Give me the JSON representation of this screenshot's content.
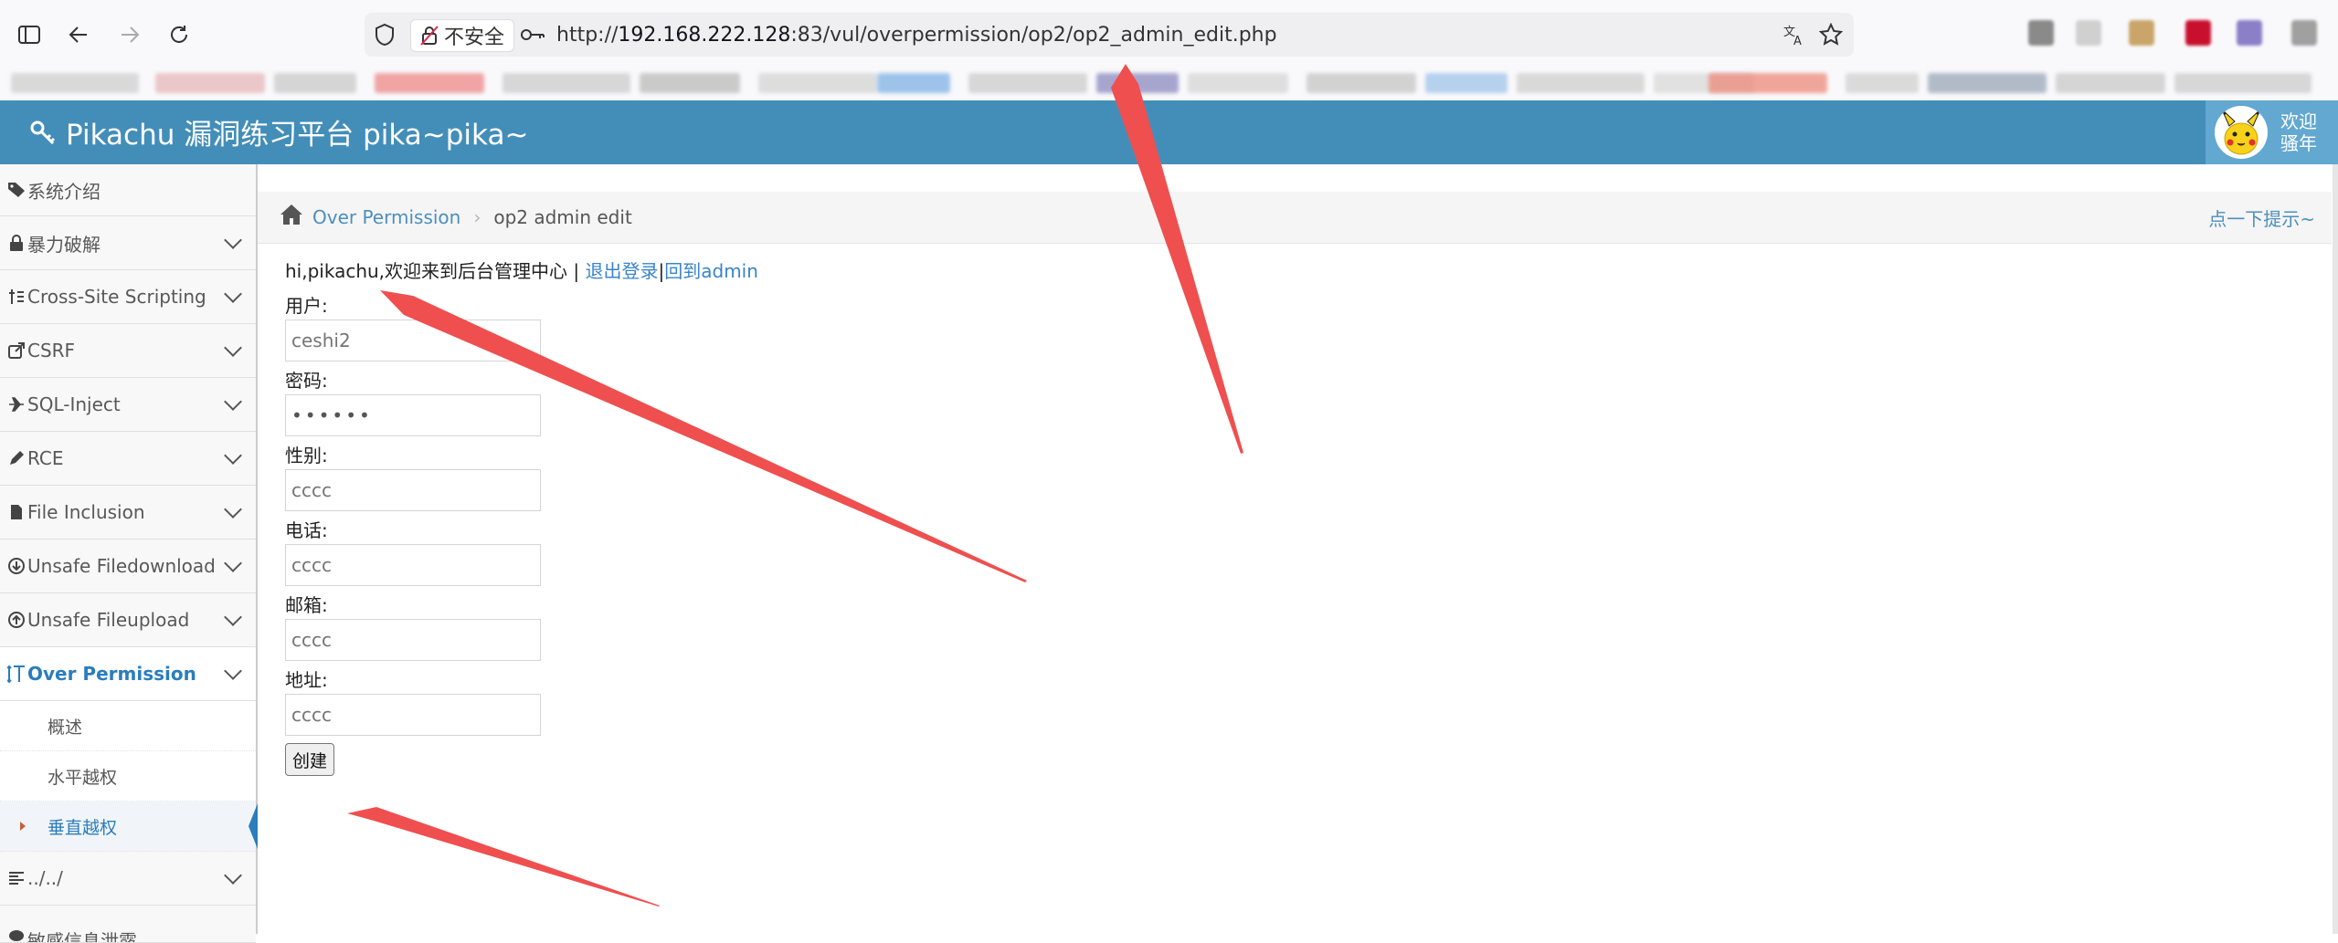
{
  "browser": {
    "security_label": "不安全",
    "url_prefix": "http://",
    "url_host": "192.168.222.128",
    "url_rest": ":83/vul/overpermission/op2/op2_admin_edit.php"
  },
  "header": {
    "title": "Pikachu 漏洞练习平台 pika~pika~",
    "welcome_line1": "欢迎",
    "welcome_line2": "骚年"
  },
  "sidebar": {
    "items": [
      {
        "label": "系统介绍",
        "icon": "tag-icon"
      },
      {
        "label": "暴力破解",
        "icon": "lock-icon"
      },
      {
        "label": "Cross-Site Scripting",
        "icon": "xss-icon"
      },
      {
        "label": "CSRF",
        "icon": "share-icon"
      },
      {
        "label": "SQL-Inject",
        "icon": "plane-icon"
      },
      {
        "label": "RCE",
        "icon": "pencil-icon"
      },
      {
        "label": "File Inclusion",
        "icon": "file-icon"
      },
      {
        "label": "Unsafe Filedownload",
        "icon": "download-icon"
      },
      {
        "label": "Unsafe Fileupload",
        "icon": "upload-icon"
      },
      {
        "label": "Over Permission",
        "icon": "text-height-icon"
      },
      {
        "label": "../../",
        "icon": "align-icon"
      },
      {
        "label": "敏感信息泄露",
        "icon": "eye-icon"
      }
    ],
    "subitems": [
      {
        "label": "概述"
      },
      {
        "label": "水平越权"
      },
      {
        "label": "垂直越权"
      }
    ]
  },
  "breadcrumb": {
    "link": "Over Permission",
    "current": "op2 admin edit",
    "hint": "点一下提示~"
  },
  "main": {
    "welcome_prefix": "hi,pikachu,欢迎来到后台管理中心 | ",
    "logout": "退出登录",
    "sep": "|",
    "back": "回到admin",
    "fields": [
      {
        "label": "用户:",
        "value": "ceshi2"
      },
      {
        "label": "密码:",
        "value": "••••••"
      },
      {
        "label": "性别:",
        "value": "cccc"
      },
      {
        "label": "电话:",
        "value": "cccc"
      },
      {
        "label": "邮箱:",
        "value": "cccc"
      },
      {
        "label": "地址:",
        "value": "cccc"
      }
    ],
    "submit": "创建"
  }
}
